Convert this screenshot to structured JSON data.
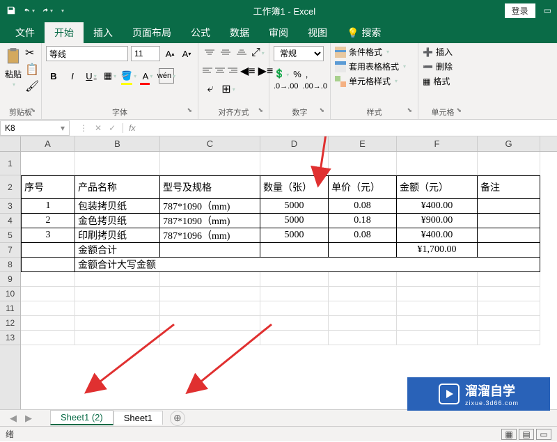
{
  "title": "工作簿1 - Excel",
  "login": "登录",
  "menu": {
    "file": "文件",
    "home": "开始",
    "insert": "插入",
    "layout": "页面布局",
    "formula": "公式",
    "data": "数据",
    "review": "审阅",
    "view": "视图",
    "search": "搜索"
  },
  "ribbon": {
    "clipboard": {
      "paste": "粘贴",
      "label": "剪贴板"
    },
    "font": {
      "name": "等线",
      "size": "11",
      "label": "字体"
    },
    "align": {
      "label": "对齐方式"
    },
    "number": {
      "format": "常规",
      "label": "数字"
    },
    "styles": {
      "cond": "条件格式",
      "table": "套用表格格式",
      "cell": "单元格样式",
      "label": "样式"
    },
    "cells": {
      "insert": "插入",
      "delete": "删除",
      "format": "格式",
      "label": "单元格"
    }
  },
  "namebox": "K8",
  "fx": "fx",
  "columns": [
    "A",
    "B",
    "C",
    "D",
    "E",
    "F",
    "G"
  ],
  "rows": [
    "1",
    "2",
    "3",
    "4",
    "5",
    "7",
    "8",
    "9",
    "10",
    "11",
    "12",
    "13"
  ],
  "table": {
    "headers": {
      "seq": "序号",
      "product": "产品名称",
      "spec": "型号及规格",
      "qty": "数量（张）",
      "price": "单价（元）",
      "amount": "金额（元）",
      "remark": "备注"
    },
    "rows": [
      {
        "seq": "1",
        "product": "包装拷贝纸",
        "spec": "787*1090（mm)",
        "qty": "5000",
        "price": "0.08",
        "amount": "¥400.00"
      },
      {
        "seq": "2",
        "product": "金色拷贝纸",
        "spec": "787*1090（mm)",
        "qty": "5000",
        "price": "0.18",
        "amount": "¥900.00"
      },
      {
        "seq": "3",
        "product": "印刷拷贝纸",
        "spec": "787*1096（mm)",
        "qty": "5000",
        "price": "0.08",
        "amount": "¥400.00"
      }
    ],
    "total_label": "金额合计",
    "total_value": "¥1,700.00",
    "cn_total_label": "金额合计大写金额"
  },
  "sheets": {
    "tab1": "Sheet1 (2)",
    "tab2": "Sheet1"
  },
  "status": "绪",
  "watermark": {
    "cn": "溜溜自学",
    "en": "zixue.3d66.com"
  }
}
